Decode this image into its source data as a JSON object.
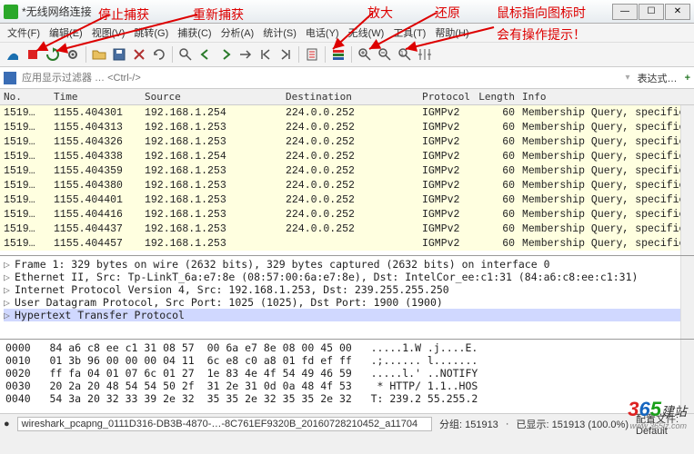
{
  "window": {
    "title": "*无线网络连接"
  },
  "winbtns": {
    "min": "—",
    "max": "☐",
    "close": "✕"
  },
  "menu": [
    "文件(F)",
    "编辑(E)",
    "视图(V)",
    "跳转(G)",
    "捕获(C)",
    "分析(A)",
    "统计(S)",
    "电话(Y)",
    "无线(W)",
    "工具(T)",
    "帮助(H)"
  ],
  "annotations": {
    "stop": "停止捕获",
    "restart": "重新捕获",
    "zoomin": "放大",
    "reset": "还原",
    "tip1": "鼠标指向图标时",
    "tip2": "会有操作提示！"
  },
  "filter": {
    "placeholder": "应用显示过滤器 … <Ctrl-/>",
    "expr_label": "表达式…",
    "plus": "+"
  },
  "columns": {
    "no": "No.",
    "time": "Time",
    "src": "Source",
    "dst": "Destination",
    "proto": "Protocol",
    "len": "Length",
    "info": "Info"
  },
  "packets": [
    {
      "no": "1519…",
      "time": "1155.404301",
      "src": "192.168.1.254",
      "dst": "224.0.0.252",
      "proto": "IGMPv2",
      "len": "60",
      "info": "Membership Query, specific …"
    },
    {
      "no": "1519…",
      "time": "1155.404313",
      "src": "192.168.1.253",
      "dst": "224.0.0.252",
      "proto": "IGMPv2",
      "len": "60",
      "info": "Membership Query, specific …"
    },
    {
      "no": "1519…",
      "time": "1155.404326",
      "src": "192.168.1.253",
      "dst": "224.0.0.252",
      "proto": "IGMPv2",
      "len": "60",
      "info": "Membership Query, specific …"
    },
    {
      "no": "1519…",
      "time": "1155.404338",
      "src": "192.168.1.254",
      "dst": "224.0.0.252",
      "proto": "IGMPv2",
      "len": "60",
      "info": "Membership Query, specific …"
    },
    {
      "no": "1519…",
      "time": "1155.404359",
      "src": "192.168.1.253",
      "dst": "224.0.0.252",
      "proto": "IGMPv2",
      "len": "60",
      "info": "Membership Query, specific …"
    },
    {
      "no": "1519…",
      "time": "1155.404380",
      "src": "192.168.1.253",
      "dst": "224.0.0.252",
      "proto": "IGMPv2",
      "len": "60",
      "info": "Membership Query, specific …"
    },
    {
      "no": "1519…",
      "time": "1155.404401",
      "src": "192.168.1.253",
      "dst": "224.0.0.252",
      "proto": "IGMPv2",
      "len": "60",
      "info": "Membership Query, specific …"
    },
    {
      "no": "1519…",
      "time": "1155.404416",
      "src": "192.168.1.253",
      "dst": "224.0.0.252",
      "proto": "IGMPv2",
      "len": "60",
      "info": "Membership Query, specific …"
    },
    {
      "no": "1519…",
      "time": "1155.404437",
      "src": "192.168.1.253",
      "dst": "224.0.0.252",
      "proto": "IGMPv2",
      "len": "60",
      "info": "Membership Query, specific …"
    },
    {
      "no": "1519…",
      "time": "1155.404457",
      "src": "192.168.1.253",
      "dst": "",
      "proto": "IGMPv2",
      "len": "60",
      "info": "Membership Query, specific …"
    }
  ],
  "details": {
    "l0": "Frame 1: 329 bytes on wire (2632 bits), 329 bytes captured (2632 bits) on interface 0",
    "l1": "Ethernet II, Src: Tp-LinkT_6a:e7:8e (08:57:00:6a:e7:8e), Dst: IntelCor_ee:c1:31 (84:a6:c8:ee:c1:31)",
    "l2": "Internet Protocol Version 4, Src: 192.168.1.253, Dst: 239.255.255.250",
    "l3": "User Datagram Protocol, Src Port: 1025 (1025), Dst Port: 1900 (1900)",
    "l4": "Hypertext Transfer Protocol"
  },
  "hex": {
    "r0": {
      "off": "0000",
      "b": "84 a6 c8 ee c1 31 08 57  00 6a e7 8e 08 00 45 00",
      "a": ".....1.W .j....E."
    },
    "r1": {
      "off": "0010",
      "b": "01 3b 96 00 00 00 04 11  6c e8 c0 a8 01 fd ef ff",
      "a": ".;...... l......."
    },
    "r2": {
      "off": "0020",
      "b": "ff fa 04 01 07 6c 01 27  1e 83 4e 4f 54 49 46 59",
      "a": ".....l.' ..NOTIFY"
    },
    "r3": {
      "off": "0030",
      "b": "20 2a 20 48 54 54 50 2f  31 2e 31 0d 0a 48 4f 53",
      "a": " * HTTP/ 1.1..HOS"
    },
    "r4": {
      "off": "0040",
      "b": "54 3a 20 32 33 39 2e 32  35 35 2e 32 35 35 2e 32",
      "a": "T: 239.2 55.255.2"
    }
  },
  "status": {
    "file": "wireshark_pcapng_0111D316-DB3B-4870-…-8C761EF9320B_20160728210452_a11704",
    "packets": "分组: 151913",
    "displayed": "已显示: 151913 (100.0%)",
    "profile": "配置文件: Default"
  },
  "watermark": {
    "brand": "365",
    "suffix": "建站",
    "url": "www.365jz.com"
  }
}
